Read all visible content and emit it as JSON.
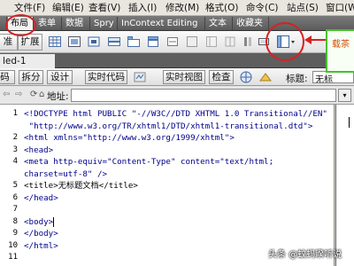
{
  "menu": {
    "items": [
      {
        "label": "文件(F)"
      },
      {
        "label": "编辑(E)"
      },
      {
        "label": "查看(V)"
      },
      {
        "label": "插入(I)"
      },
      {
        "label": "修改(M)"
      },
      {
        "label": "格式(O)"
      },
      {
        "label": "命令(C)"
      },
      {
        "label": "站点(S)"
      },
      {
        "label": "窗口(W"
      }
    ]
  },
  "insert_tabs": {
    "items": [
      {
        "label": "布局",
        "active": true
      },
      {
        "label": "表单"
      },
      {
        "label": "数据"
      },
      {
        "label": "Spry"
      },
      {
        "label": "InContext Editing"
      },
      {
        "label": "文本"
      },
      {
        "label": "收藏夹"
      }
    ]
  },
  "toolbar": {
    "standard_label": "准",
    "expand_label": "扩展"
  },
  "callout": {
    "text": "载茶"
  },
  "document": {
    "tab_label": "led-1"
  },
  "viewbar": {
    "code_label": "码",
    "split_label": "拆分",
    "design_label": "设计",
    "live_code_label": "实时代码",
    "live_view_label": "实时视图",
    "inspect_label": "检查",
    "title_label": "标题:",
    "title_value": "无标"
  },
  "address": {
    "label": "地址:",
    "value": ""
  },
  "code": {
    "line_numbers": [
      "1",
      "2",
      "3",
      "4",
      "5",
      "6",
      "7",
      "8",
      "9",
      "10",
      "11"
    ],
    "lines": [
      "<!DOCTYPE html PUBLIC \"-//W3C//DTD XHTML 1.0 Transitional//EN\"",
      " \"http://www.w3.org/TR/xhtml1/DTD/xhtml1-transitional.dtd\">",
      "<html xmlns=\"http://www.w3.org/1999/xhtml\">",
      "<head>",
      "<meta http-equiv=\"Content-Type\" content=\"text/html;",
      "charset=utf-8\" />",
      "<title>无标题文档</title>",
      "</head>",
      "",
      "<body>",
      "</body>",
      "</html>"
    ]
  },
  "watermark": {
    "text": "头条 @蚊蚂睽听说"
  },
  "colors": {
    "annotation_red": "#d92020",
    "callout_green": "#46c12e",
    "tab_bar": "#5b5b5b"
  }
}
